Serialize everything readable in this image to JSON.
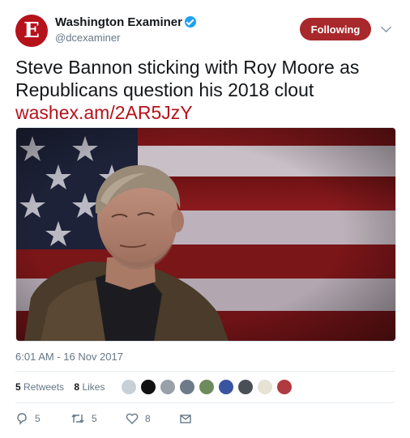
{
  "account": {
    "display_name": "Washington Examiner",
    "handle": "@dcexaminer",
    "avatar_letter": "E",
    "verified": true
  },
  "follow_button": {
    "label": "Following",
    "color": "#a8282c"
  },
  "tweet": {
    "text": "Steve Bannon sticking with Roy Moore as Republicans question his 2018 clout",
    "link": "washex.am/2AR5JzY",
    "link_color": "#b5121b"
  },
  "timestamp": "6:01 AM - 16 Nov 2017",
  "stats": {
    "retweets_count": "5",
    "retweets_label": "Retweets",
    "likes_count": "8",
    "likes_label": "Likes"
  },
  "likers_icon": "avatar-icon",
  "actions": {
    "reply_count": "5",
    "retweet_count": "5",
    "like_count": "8"
  }
}
